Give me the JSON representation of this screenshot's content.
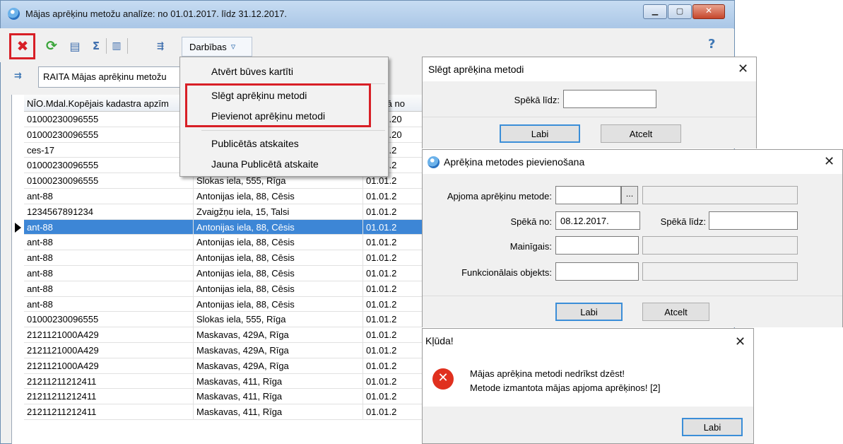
{
  "main_window": {
    "title": "Mājas aprēķinu metožu analīze: no 01.01.2017. līdz 31.12.2017."
  },
  "toolbar": {
    "actions_label": "Darbības",
    "actions_arrow": "▿",
    "help": "?"
  },
  "filter": {
    "value": "RAITA Mājas aprēķinu metožu"
  },
  "grid": {
    "columns": [
      "NĪO.Mdal.Kopējais kadastra apzīm",
      "",
      "Spēkā no"
    ],
    "rows": [
      [
        "01000230096555",
        "",
        "01.01.20"
      ],
      [
        "01000230096555",
        "",
        "01.01.20"
      ],
      [
        "ces-17",
        "",
        "01.01.2"
      ],
      [
        "01000230096555",
        "",
        "01.04.2"
      ],
      [
        "01000230096555",
        "Slokas iela, 555, Rīga",
        "01.01.2"
      ],
      [
        "ant-88",
        "Antonijas iela, 88, Cēsis",
        "01.01.2"
      ],
      [
        "1234567891234",
        "Zvaigžņu iela, 15, Talsi",
        "01.01.2"
      ],
      [
        "ant-88",
        "Antonijas iela, 88, Cēsis",
        "01.01.2"
      ],
      [
        "ant-88",
        "Antonijas iela, 88, Cēsis",
        "01.01.2"
      ],
      [
        "ant-88",
        "Antonijas iela, 88, Cēsis",
        "01.01.2"
      ],
      [
        "ant-88",
        "Antonijas iela, 88, Cēsis",
        "01.01.2"
      ],
      [
        "ant-88",
        "Antonijas iela, 88, Cēsis",
        "01.01.2"
      ],
      [
        "ant-88",
        "Antonijas iela, 88, Cēsis",
        "01.01.2"
      ],
      [
        "01000230096555",
        "Slokas iela, 555, Rīga",
        "01.01.2"
      ],
      [
        "2121121000A429",
        "Maskavas, 429A, Rīga",
        "01.01.2"
      ],
      [
        "2121121000A429",
        "Maskavas, 429A, Rīga",
        "01.01.2"
      ],
      [
        "2121121000A429",
        "Maskavas, 429A, Rīga",
        "01.01.2"
      ],
      [
        "21211211212411",
        "Maskavas, 411, Rīga",
        "01.01.2"
      ],
      [
        "21211211212411",
        "Maskavas, 411, Rīga",
        "01.01.2"
      ],
      [
        "21211211212411",
        "Maskavas, 411, Rīga",
        "01.01.2"
      ]
    ],
    "selected_index": 7
  },
  "actions_menu": {
    "items": [
      "Atvērt būves kartīti",
      "Slēgt aprēķinu metodi",
      "Pievienot aprēķinu metodi",
      "Publicētās atskaites",
      "Jauna Publicētā atskaite"
    ]
  },
  "close_dialog": {
    "title": "Slēgt aprēķina metodi",
    "valid_to_label": "Spēkā līdz:",
    "valid_to_value": "",
    "ok": "Labi",
    "cancel": "Atcelt"
  },
  "add_dialog": {
    "title": "Aprēķina metodes pievienošana",
    "method_label": "Apjoma aprēķinu metode:",
    "method_button": "...",
    "valid_from_label": "Spēkā no:",
    "valid_from_value": "08.12.2017.",
    "valid_to_label": "Spēkā līdz:",
    "variable_label": "Mainīgais:",
    "functional_label": "Funkcionālais objekts:",
    "ok": "Labi",
    "cancel": "Atcelt"
  },
  "error_dialog": {
    "title": "Kļūda!",
    "line1": "Mājas aprēķina metodi nedrīkst dzēst!",
    "line2": "Metode izmantota mājas apjoma aprēķinos! [2]",
    "ok": "Labi"
  },
  "colors": {
    "highlight": "#d81f26",
    "selection": "#3d86d6",
    "error": "#e0301e"
  },
  "icons": [
    "app-globe-icon",
    "delete-icon",
    "refresh-icon",
    "print-icon",
    "sum-icon",
    "columns-icon",
    "tree-icon",
    "chevron-down-icon",
    "help-icon",
    "filter-icon",
    "close-icon",
    "error-icon"
  ]
}
